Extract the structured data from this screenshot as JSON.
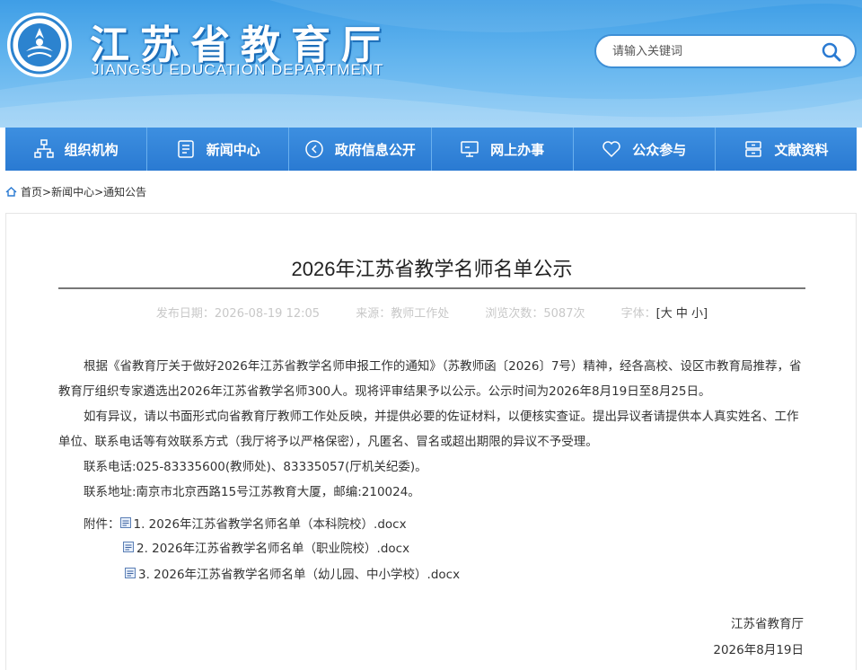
{
  "header": {
    "title": "江苏省教育厅",
    "subtitle": "JIANGSU EDUCATION DEPARTMENT",
    "search_placeholder": "请输入关键词"
  },
  "nav": {
    "items": [
      {
        "label": "组织机构",
        "icon": "org-chart-icon"
      },
      {
        "label": "新闻中心",
        "icon": "document-icon"
      },
      {
        "label": "政府信息公开",
        "icon": "arrow-circle-icon"
      },
      {
        "label": "网上办事",
        "icon": "monitor-icon"
      },
      {
        "label": "公众参与",
        "icon": "heart-icon"
      },
      {
        "label": "文献资料",
        "icon": "archive-icon"
      }
    ]
  },
  "breadcrumb": {
    "home": "首页",
    "sep1": ">",
    "news": "新闻中心",
    "sep2": ">",
    "notice": "通知公告"
  },
  "article": {
    "title": "2026年江苏省教学名师名单公示",
    "meta": {
      "date_label": "发布日期：",
      "date": "2026-08-19 12:05",
      "source_label": "来源：",
      "source": "教师工作处",
      "views_label": "浏览次数：",
      "views": "5087次",
      "font_label": "字体：",
      "bracket_open": "[",
      "size_large": "大",
      "size_medium": "中",
      "size_small": "小",
      "bracket_close": "]"
    },
    "para1": "根据《省教育厅关于做好2026年江苏省教学名师申报工作的通知》（苏教师函〔2026〕7号）精神，经各高校、设区市教育局推荐，省教育厅组织专家遴选出2026年江苏省教学名师300人。现将评审结果予以公示。公示时间为2026年8月19日至8月25日。",
    "para2": "如有异议，请以书面形式向省教育厅教师工作处反映，并提供必要的佐证材料，以便核实查证。提出异议者请提供本人真实姓名、工作单位、联系电话等有效联系方式（我厅将予以严格保密），凡匿名、冒名或超出期限的异议不予受理。",
    "phone": "联系电话:025-83335600(教师处)、83335057(厅机关纪委)。",
    "address": "联系地址:南京市北京西路15号江苏教育大厦，邮编:210024。",
    "attachments_label": "附件：",
    "attachments": [
      "1. 2026年江苏省教学名师名单（本科院校）.docx",
      "2. 2026年江苏省教学名师名单（职业院校）.docx",
      "3. 2026年江苏省教学名师名单（幼儿园、中小学校）.docx"
    ],
    "signer": "江苏省教育厅",
    "sign_date": "2026年8月19日"
  },
  "colors": {
    "header_top": "#3f9ee6",
    "header_bottom": "#8ccaf5",
    "nav_bg": "#2a7ad2",
    "search_border": "#3d8fd6"
  }
}
